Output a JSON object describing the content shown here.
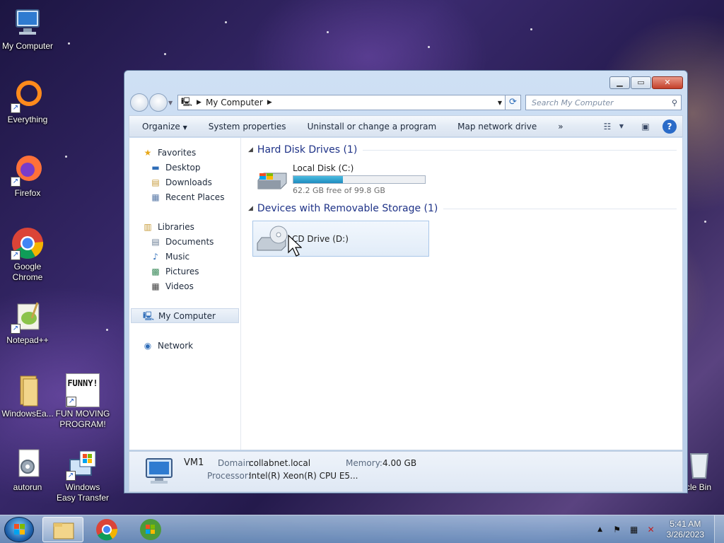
{
  "desktop": {
    "icons": [
      {
        "label": "My Computer"
      },
      {
        "label": "Everything"
      },
      {
        "label": "Firefox"
      },
      {
        "label": "Google Chrome"
      },
      {
        "label": "Notepad++"
      },
      {
        "label": "WindowsEa..."
      },
      {
        "label": "FUN MOVING PROGRAM!",
        "thumb_text": "FUNNY!"
      },
      {
        "label": "autorun"
      },
      {
        "label": "Windows Easy Transfer"
      },
      {
        "label": "cle Bin"
      }
    ]
  },
  "window": {
    "address": {
      "crumb": "My Computer"
    },
    "search": {
      "placeholder": "Search My Computer"
    },
    "toolbar": {
      "organize": "Organize",
      "system_properties": "System properties",
      "uninstall": "Uninstall or change a program",
      "map_network": "Map network drive",
      "more": "»"
    },
    "nav": {
      "favorites": "Favorites",
      "desktop": "Desktop",
      "downloads": "Downloads",
      "recent": "Recent Places",
      "libraries": "Libraries",
      "documents": "Documents",
      "music": "Music",
      "pictures": "Pictures",
      "videos": "Videos",
      "my_computer": "My Computer",
      "network": "Network"
    },
    "groups": {
      "hdd": "Hard Disk Drives (1)",
      "removable": "Devices with Removable Storage (1)"
    },
    "drives": {
      "c": {
        "name": "Local Disk (C:)",
        "free_text": "62.2 GB free of 99.8 GB",
        "used_fraction": 0.377
      },
      "d": {
        "name": "CD Drive (D:)"
      }
    },
    "details": {
      "name": "VM1",
      "domain_label": "Domain:",
      "domain": "collabnet.local",
      "memory_label": "Memory:",
      "memory": "4.00 GB",
      "processor_label": "Processor:",
      "processor": "Intel(R) Xeon(R) CPU E5..."
    }
  },
  "taskbar": {
    "time": "5:41 AM",
    "date": "3/26/2023"
  },
  "colors": {
    "accent": "#1e3287",
    "bar_fill": "#1e8cbf"
  }
}
